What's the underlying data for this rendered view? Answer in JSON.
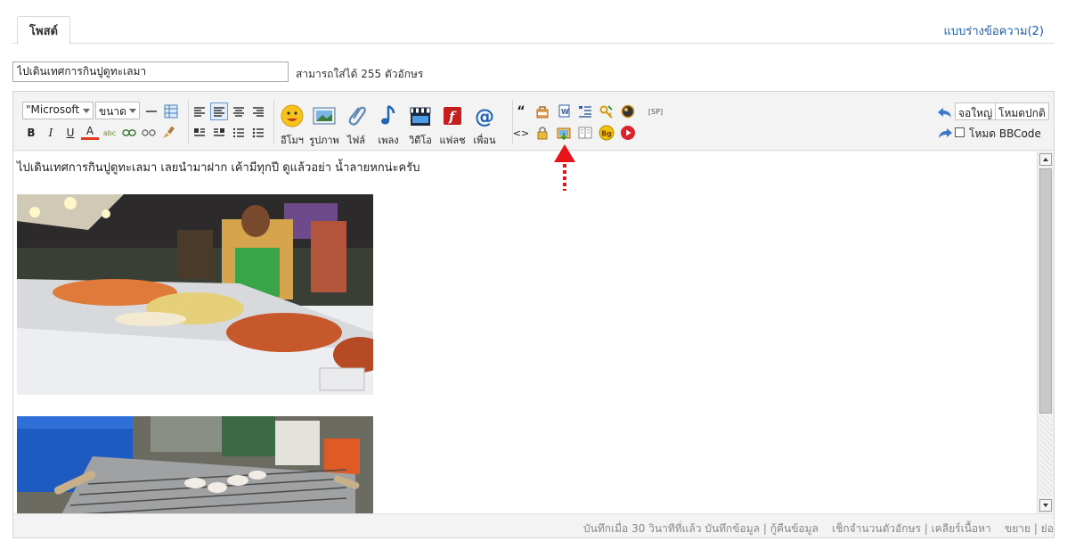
{
  "tabs": {
    "post_tab": "โพสต์",
    "draft_link": "แบบร่างข้อความ(2)"
  },
  "subject": {
    "value": "ไปเดินเทศการกินปูดูทะเลมา",
    "hint": "สามารถใส่ได้ 255 ตัวอักษร"
  },
  "toolbar": {
    "font_select": "\"Microsoft",
    "size_select": "ขนาด",
    "bold": "B",
    "italic": "I",
    "underline": "U",
    "font_color": "A",
    "spell": "abc",
    "media_buttons": [
      {
        "label": "อีโมฯ",
        "icon": "smiley-icon"
      },
      {
        "label": "รูปภาพ",
        "icon": "image-icon"
      },
      {
        "label": "ไฟล์",
        "icon": "paperclip-icon"
      },
      {
        "label": "เพลง",
        "icon": "music-note-icon"
      },
      {
        "label": "วิดีโอ",
        "icon": "clapperboard-icon"
      },
      {
        "label": "แฟลช",
        "icon": "flash-icon"
      },
      {
        "label": "เพื่อน",
        "icon": "at-icon"
      }
    ],
    "quote": "“",
    "code": "<>",
    "sp_tag": "[SP]",
    "bg_badge": "Bg",
    "fullscreen": "จอใหญ่",
    "normal_mode": "โหมดปกติ",
    "bbcode_mode": "โหมด BBCode"
  },
  "content": {
    "text": "ไปเดินเทศการกินปูดูทะเลมา เลยนำมาฝาก เค้ามีทุกปี ดูแล้วอย่า น้ำลายหกน่ะครับ"
  },
  "status": {
    "autosave": "บันทึกเมื่อ 30 วินาทีที่แล้ว",
    "save": "บันทึกข้อมูล",
    "restore": "กู้คืนข้อมูล",
    "check_count": "เช็กจำนวนตัวอักษร",
    "clear": "เคลียร์เนื้อหา",
    "expand": "ขยาย",
    "shrink": "ย่อ",
    "sep": "|"
  },
  "colors": {
    "link": "#1a5fb4",
    "annotation": "#e8141a"
  }
}
